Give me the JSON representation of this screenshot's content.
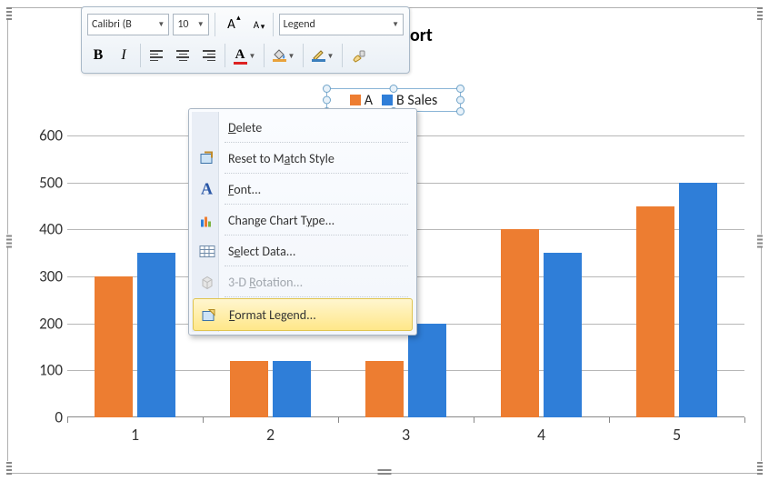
{
  "toolbar": {
    "font_name": "Calibri (B",
    "font_size": "10",
    "grow_font_label": "A",
    "shrink_font_label": "A",
    "element_picker": "Legend",
    "bold_label": "B",
    "italic_label": "I",
    "font_color_label": "A",
    "font_color_value": "#d22",
    "fill_color_value": "#e9a23b",
    "border_color_value": "#3b7fbd"
  },
  "chart_title_fragment": "ort",
  "legend": {
    "seriesA": "A",
    "seriesB": "B Sales"
  },
  "context_menu": {
    "delete": "Delete",
    "reset": "Reset to Match Style",
    "font": "Font...",
    "change_type": "Change Chart Type...",
    "select_data": "Select Data...",
    "rotation": "3-D Rotation...",
    "format_legend": "Format Legend..."
  },
  "chart_data": {
    "type": "bar",
    "title": "(partial) …ort",
    "categories": [
      "1",
      "2",
      "3",
      "4",
      "5"
    ],
    "series": [
      {
        "name": "A",
        "color": "#ed7d31",
        "values": [
          300,
          120,
          120,
          400,
          450
        ]
      },
      {
        "name": "B Sales",
        "color": "#2f7ed8",
        "values": [
          350,
          120,
          200,
          350,
          500
        ]
      }
    ],
    "ylim": [
      0,
      600
    ],
    "yticks": [
      0,
      100,
      200,
      300,
      400,
      500,
      600
    ],
    "xlabel": "",
    "ylabel": ""
  }
}
